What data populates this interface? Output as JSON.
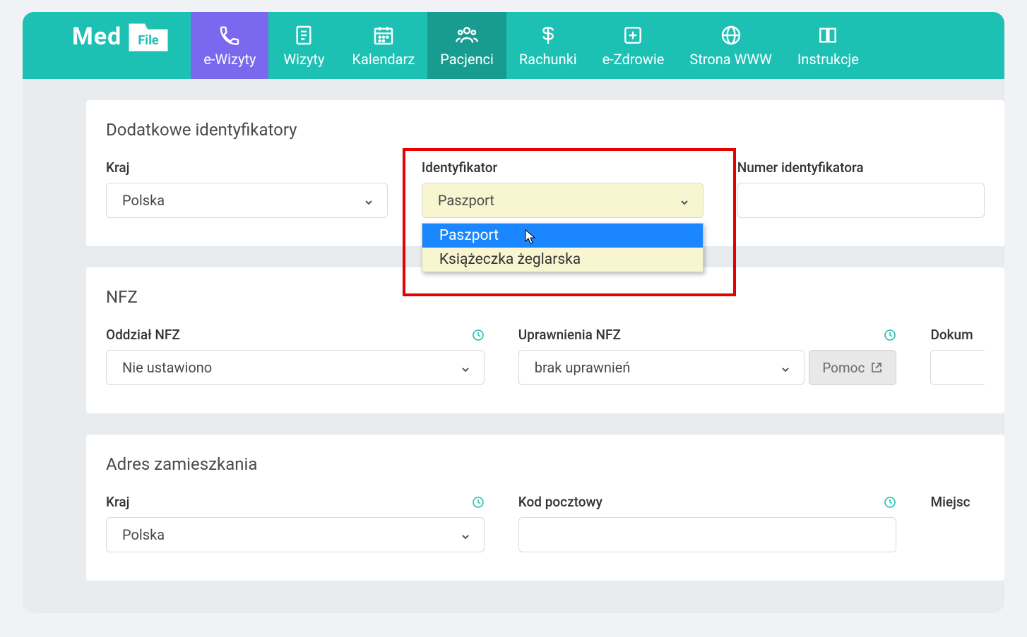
{
  "logo": {
    "text_part1": "Med",
    "text_part2": "File"
  },
  "nav": [
    {
      "label": "e-Wizyty",
      "icon": "phone"
    },
    {
      "label": "Wizyty",
      "icon": "clipboard"
    },
    {
      "label": "Kalendarz",
      "icon": "calendar"
    },
    {
      "label": "Pacjenci",
      "icon": "people"
    },
    {
      "label": "Rachunki",
      "icon": "dollar"
    },
    {
      "label": "e-Zdrowie",
      "icon": "plus-square"
    },
    {
      "label": "Strona WWW",
      "icon": "globe"
    },
    {
      "label": "Instrukcje",
      "icon": "book"
    }
  ],
  "section1": {
    "title": "Dodatkowe identyfikatory",
    "kraj_label": "Kraj",
    "kraj_value": "Polska",
    "identyfikator_label": "Identyfikator",
    "identyfikator_value": "Paszport",
    "identyfikator_options": [
      "Paszport",
      "Książeczka żeglarska"
    ],
    "numer_label": "Numer identyfikatora",
    "numer_value": ""
  },
  "section2": {
    "title": "NFZ",
    "oddzial_label": "Oddział NFZ",
    "oddzial_value": "Nie ustawiono",
    "uprawnienia_label": "Uprawnienia NFZ",
    "uprawnienia_value": "brak uprawnień",
    "pomoc_label": "Pomoc",
    "dokum_label": "Dokum"
  },
  "section3": {
    "title": "Adres zamieszkania",
    "kraj_label": "Kraj",
    "kraj_value": "Polska",
    "kod_label": "Kod pocztowy",
    "miejsc_label": "Miejsc"
  }
}
